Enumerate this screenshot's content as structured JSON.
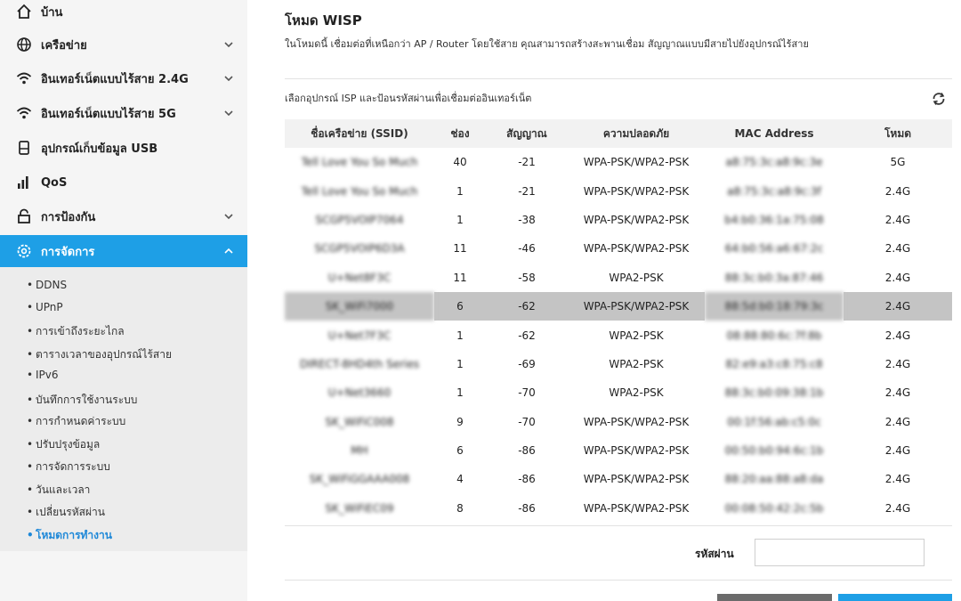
{
  "sidebar": {
    "items": [
      {
        "label": "บ้าน",
        "icon": "home-icon"
      },
      {
        "label": "เครือข่าย",
        "icon": "globe-icon"
      },
      {
        "label": "อินเทอร์เน็ตแบบไร้สาย 2.4G",
        "icon": "wifi-icon"
      },
      {
        "label": "อินเทอร์เน็ตแบบไร้สาย 5G",
        "icon": "wifi-icon"
      },
      {
        "label": "อุปกรณ์เก็บข้อมูล USB",
        "icon": "usb-storage-icon"
      },
      {
        "label": "QoS",
        "icon": "bar-chart-icon"
      },
      {
        "label": "การป้องกัน",
        "icon": "lock-icon"
      },
      {
        "label": "การจัดการ",
        "icon": "gear-icon"
      }
    ],
    "submenu": [
      "DDNS",
      "UPnP",
      "การเข้าถึงระยะไกล",
      "ตารางเวลาของอุปกรณ์ไร้สาย",
      "IPv6",
      "บันทึกการใช้งานระบบ",
      "การกำหนดค่าระบบ",
      "ปรับปรุงข้อมูล",
      "การจัดการระบบ",
      "วันและเวลา",
      "เปลี่ยนรหัสผ่าน",
      "โหมดการทำงาน"
    ],
    "active_color": "#1e9fe6"
  },
  "main": {
    "title": "โหมด WISP",
    "description": "ในโหมดนี้ เชื่อมต่อที่เหนือกว่า AP / Router โดยใช้สาย คุณสามารถสร้างสะพานเชื่อม สัญญาณแบบมีสายไปยังอุปกรณ์ไร้สาย",
    "isp_label": "เลือกอุปกรณ์ ISP และป้อนรหัสผ่านเพื่อเชื่อมต่ออินเทอร์เน็ต",
    "table": {
      "headers": [
        "ชื่อเครือข่าย (SSID)",
        "ช่อง",
        "สัญญาณ",
        "ความปลอดภัย",
        "MAC Address",
        "โหมด"
      ],
      "rows": [
        {
          "ssid": "Tell Love You So Much",
          "channel": "40",
          "signal": "-21",
          "security": "WPA-PSK/WPA2-PSK",
          "mac": "a8:75:3c:a8:9c:3e",
          "mode": "5G"
        },
        {
          "ssid": "Tell Love You So Much",
          "channel": "1",
          "signal": "-21",
          "security": "WPA-PSK/WPA2-PSK",
          "mac": "a8:75:3c:a8:9c:3f",
          "mode": "2.4G"
        },
        {
          "ssid": "SCGP5VOIP7064",
          "channel": "1",
          "signal": "-38",
          "security": "WPA-PSK/WPA2-PSK",
          "mac": "b4:b0:36:1a:75:08",
          "mode": "2.4G"
        },
        {
          "ssid": "SCGP5VOIP6D3A",
          "channel": "11",
          "signal": "-46",
          "security": "WPA-PSK/WPA2-PSK",
          "mac": "64:b0:56:a6:67:2c",
          "mode": "2.4G"
        },
        {
          "ssid": "U+Net8F3C",
          "channel": "11",
          "signal": "-58",
          "security": "WPA2-PSK",
          "mac": "88:3c:b0:3a:87:46",
          "mode": "2.4G"
        },
        {
          "ssid": "SK_WiFi7000",
          "channel": "6",
          "signal": "-62",
          "security": "WPA-PSK/WPA2-PSK",
          "mac": "88:5d:b0:18:79:3c",
          "mode": "2.4G"
        },
        {
          "ssid": "U+Net7F3C",
          "channel": "1",
          "signal": "-62",
          "security": "WPA2-PSK",
          "mac": "08:88:80:6c:7f:8b",
          "mode": "2.4G"
        },
        {
          "ssid": "DIRECT-8HD4th Series",
          "channel": "1",
          "signal": "-69",
          "security": "WPA2-PSK",
          "mac": "82:e9:a3:c8:75:c8",
          "mode": "2.4G"
        },
        {
          "ssid": "U+Net3660",
          "channel": "1",
          "signal": "-70",
          "security": "WPA2-PSK",
          "mac": "88:3c:b0:09:38:1b",
          "mode": "2.4G"
        },
        {
          "ssid": "SK_WiFiC008",
          "channel": "9",
          "signal": "-70",
          "security": "WPA-PSK/WPA2-PSK",
          "mac": "00:1f:56:ab:c5:0c",
          "mode": "2.4G"
        },
        {
          "ssid": "MH",
          "channel": "6",
          "signal": "-86",
          "security": "WPA-PSK/WPA2-PSK",
          "mac": "00:50:b0:94:6c:1b",
          "mode": "2.4G"
        },
        {
          "ssid": "SK_WiFiGGAAA008",
          "channel": "4",
          "signal": "-86",
          "security": "WPA-PSK/WPA2-PSK",
          "mac": "88:20:aa:88:a8:da",
          "mode": "2.4G"
        },
        {
          "ssid": "SK_WiFiEC09",
          "channel": "8",
          "signal": "-86",
          "security": "WPA-PSK/WPA2-PSK",
          "mac": "00:08:50:42:2c:5b",
          "mode": "2.4G"
        }
      ],
      "selected_row": 5
    },
    "password_label": "รหัสผ่าน",
    "password_value": ""
  }
}
